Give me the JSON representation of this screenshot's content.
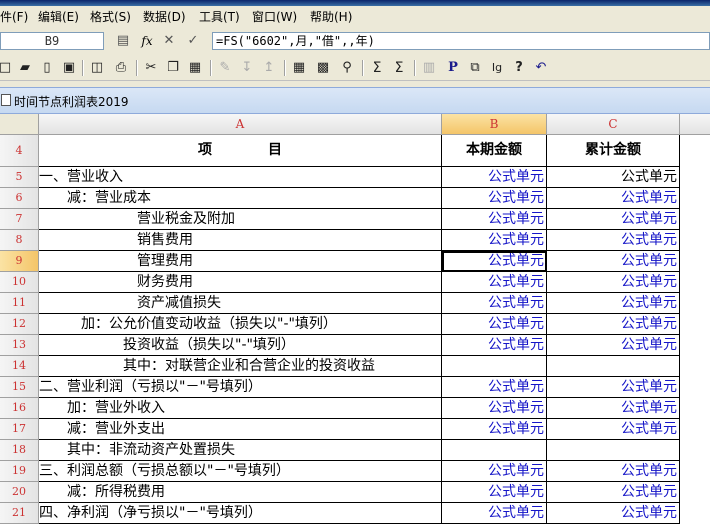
{
  "menu": [
    "件(F)",
    "编辑(E)",
    "格式(S)",
    "数据(D)",
    "工具(T)",
    "窗口(W)",
    "帮助(H)"
  ],
  "formula_bar": {
    "cell_ref": "B9",
    "fx_label": "fx",
    "formula": "=FS(\"6602\",月,\"借\",,年)"
  },
  "document": {
    "title": "时间节点利润表2019"
  },
  "columns": {
    "A": "A",
    "B": "B",
    "C": "C"
  },
  "header_row": {
    "num": "4",
    "a": "项　　　　目",
    "b": "本期金额",
    "c": "累计金额"
  },
  "rows": [
    {
      "num": "5",
      "a": "一、营业收入",
      "b": "公式单元",
      "c": "公式单元"
    },
    {
      "num": "6",
      "a": "　　减：营业成本",
      "b": "公式单元",
      "c": "公式单元"
    },
    {
      "num": "7",
      "a": "　　　　　　　营业税金及附加",
      "b": "公式单元",
      "c": "公式单元"
    },
    {
      "num": "8",
      "a": "　　　　　　　销售费用",
      "b": "公式单元",
      "c": "公式单元"
    },
    {
      "num": "9",
      "a": "　　　　　　　管理费用",
      "b": "公式单元",
      "c": "公式单元"
    },
    {
      "num": "10",
      "a": "　　　　　　　财务费用",
      "b": "公式单元",
      "c": "公式单元"
    },
    {
      "num": "11",
      "a": "　　　　　　　资产减值损失",
      "b": "公式单元",
      "c": "公式单元"
    },
    {
      "num": "12",
      "a": "　　　加：公允价值变动收益（损失以\"-\"填列）",
      "b": "公式单元",
      "c": "公式单元"
    },
    {
      "num": "13",
      "a": "　　　　　　投资收益（损失以\"-\"填列）",
      "b": "公式单元",
      "c": "公式单元"
    },
    {
      "num": "14",
      "a": "　　　　　　其中：对联营企业和合营企业的投资收益",
      "b": "",
      "c": ""
    },
    {
      "num": "15",
      "a": "二、营业利润（亏损以\"－\"号填列）",
      "b": "公式单元",
      "c": "公式单元"
    },
    {
      "num": "16",
      "a": "　　加：营业外收入",
      "b": "公式单元",
      "c": "公式单元"
    },
    {
      "num": "17",
      "a": "　　减：营业外支出",
      "b": "公式单元",
      "c": "公式单元"
    },
    {
      "num": "18",
      "a": "　　其中：非流动资产处置损失",
      "b": "",
      "c": ""
    },
    {
      "num": "19",
      "a": "三、利润总额（亏损总额以\"－\"号填列）",
      "b": "公式单元",
      "c": "公式单元"
    },
    {
      "num": "20",
      "a": "　　减：所得税费用",
      "b": "公式单元",
      "c": "公式单元"
    },
    {
      "num": "21",
      "a": "四、净利润（净亏损以\"－\"号填列）",
      "b": "公式单元",
      "c": "公式单元"
    }
  ],
  "selected_cell": "B9",
  "colors": {
    "formula_text": "#1515c8",
    "header_label": "#cc3333",
    "selection_highlight": "#f4c569"
  }
}
